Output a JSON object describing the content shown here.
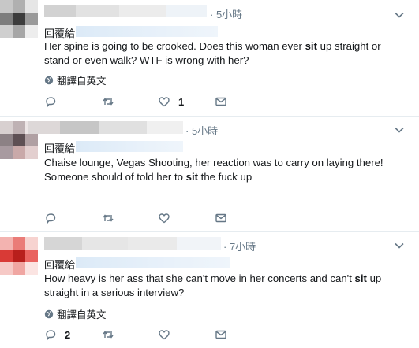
{
  "tweets": [
    {
      "time": "· 5小時",
      "reply_label": "回覆給",
      "text_before": "Her spine is going to be crooked. Does this woman ever ",
      "keyword": "sit",
      "text_after": " up straight or stand or even walk? WTF is wrong with her?",
      "translate": "翻譯自英文",
      "reply_count": "",
      "retweet_count": "",
      "like_count": "1"
    },
    {
      "time": "· 5小時",
      "reply_label": "回覆給",
      "text_before": "Chaise lounge, Vegas Shooting, her reaction was to carry on laying there! Someone should of told her to ",
      "keyword": "sit",
      "text_after": " the fuck up",
      "translate": "",
      "reply_count": "",
      "retweet_count": "",
      "like_count": ""
    },
    {
      "time": "· 7小時",
      "reply_label": "回覆給",
      "text_before": "How heavy is her ass that she can't move in her concerts and can't ",
      "keyword": "sit",
      "text_after": " up straight in a serious interview?",
      "translate": "翻譯自英文",
      "reply_count": "2",
      "retweet_count": "",
      "like_count": ""
    }
  ],
  "icons": {
    "reply": "reply-icon",
    "retweet": "retweet-icon",
    "like": "heart-icon",
    "dm": "envelope-icon",
    "globe": "globe-icon",
    "more": "chevron-down-icon"
  },
  "colors": {
    "text": "#14171a",
    "muted": "#657786",
    "divider": "#e6ecf0",
    "reply_blur": "#dceaf7"
  }
}
